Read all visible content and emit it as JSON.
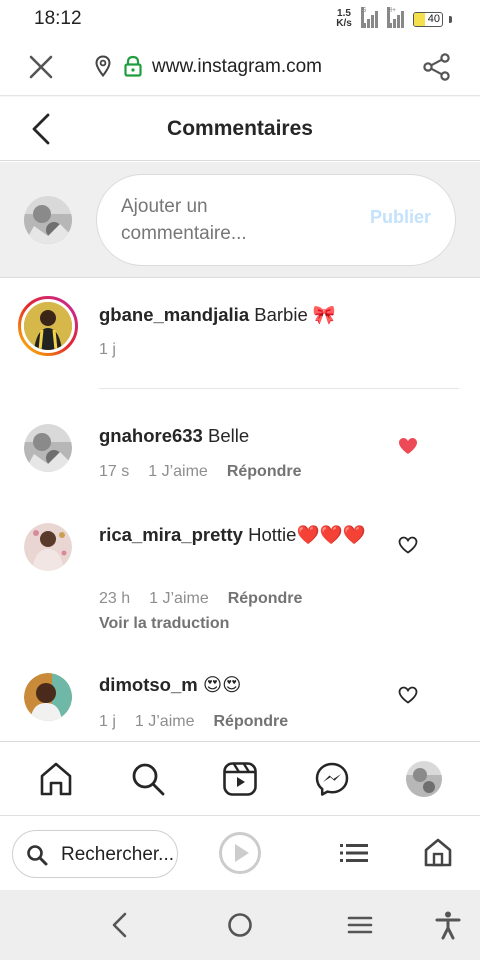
{
  "status_bar": {
    "time": "18:12",
    "net_speed_value": "1.5",
    "net_speed_unit": "K/s",
    "signal_1_label": "G",
    "signal_2_label": "H+",
    "battery_level": "40"
  },
  "browser": {
    "url": "www.instagram.com",
    "search_label": "Rechercher..."
  },
  "header": {
    "title": "Commentaires"
  },
  "composer": {
    "placeholder": "Ajouter un commentaire...",
    "publish_label": "Publier"
  },
  "comments": [
    {
      "username": "gbane_mandjalia",
      "text": "Barbie 🎀",
      "time": "1 j",
      "liked": false,
      "caption": true
    },
    {
      "username": "gnahore633",
      "text": "Belle",
      "time": "17 s",
      "likes": "1 J’aime",
      "reply": "Répondre",
      "liked": true
    },
    {
      "username": "rica_mira_pretty",
      "text": "Hottie❤️❤️❤️",
      "time": "23 h",
      "likes": "1 J’aime",
      "reply": "Répondre",
      "translate": "Voir la traduction",
      "liked": false
    },
    {
      "username": "dimotso_m",
      "text": "😍😍",
      "time": "1 j",
      "likes": "1 J’aime",
      "reply": "Répondre",
      "liked": false
    }
  ],
  "colors": {
    "heart_liked": "#ed4956",
    "publish_disabled": "#c4e2fb",
    "meta_grey": "#8e8e8e"
  }
}
